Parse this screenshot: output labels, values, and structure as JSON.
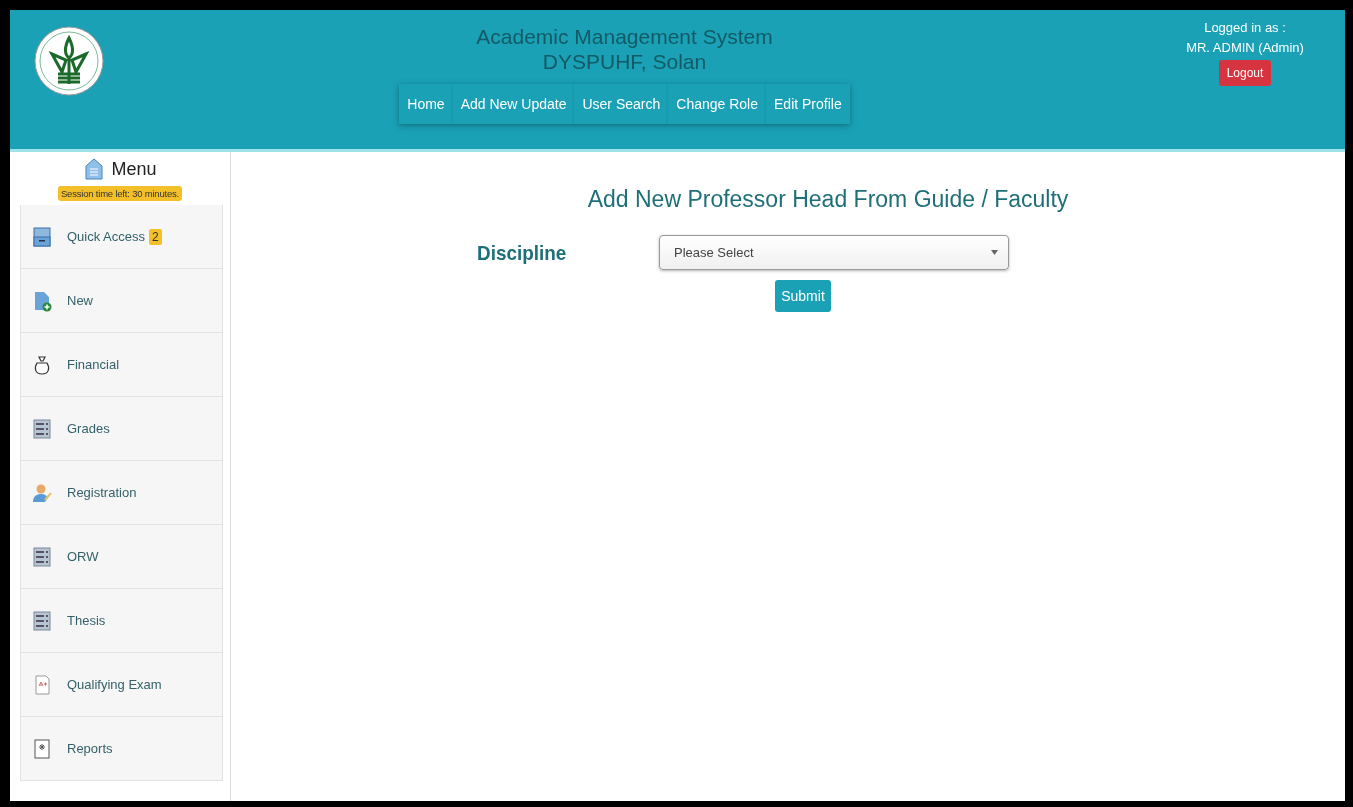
{
  "header": {
    "title": "Academic Management System",
    "subtitle": "DYSPUHF, Solan",
    "nav": [
      {
        "label": "Home"
      },
      {
        "label": "Add New Update"
      },
      {
        "label": "User Search"
      },
      {
        "label": "Change Role"
      },
      {
        "label": "Edit Profile"
      }
    ],
    "logged_in_label": "Logged in as :",
    "user": "MR. ADMIN (Admin)",
    "logout": "Logout"
  },
  "sidebar": {
    "title": "Menu",
    "session": "Session time left: 30 minutes.",
    "items": [
      {
        "label": "Quick Access",
        "kind": "drawer",
        "badge": "2"
      },
      {
        "label": "New",
        "kind": "new"
      },
      {
        "label": "Financial",
        "kind": "bag"
      },
      {
        "label": "Grades",
        "kind": "grid"
      },
      {
        "label": "Registration",
        "kind": "person"
      },
      {
        "label": "ORW",
        "kind": "grid"
      },
      {
        "label": "Thesis",
        "kind": "grid"
      },
      {
        "label": "Qualifying Exam",
        "kind": "paper"
      },
      {
        "label": "Reports",
        "kind": "report"
      }
    ]
  },
  "form": {
    "heading": "Add New Professor Head From Guide / Faculty",
    "field_label": "Discipline",
    "select_value": "Please Select",
    "submit": "Submit"
  }
}
